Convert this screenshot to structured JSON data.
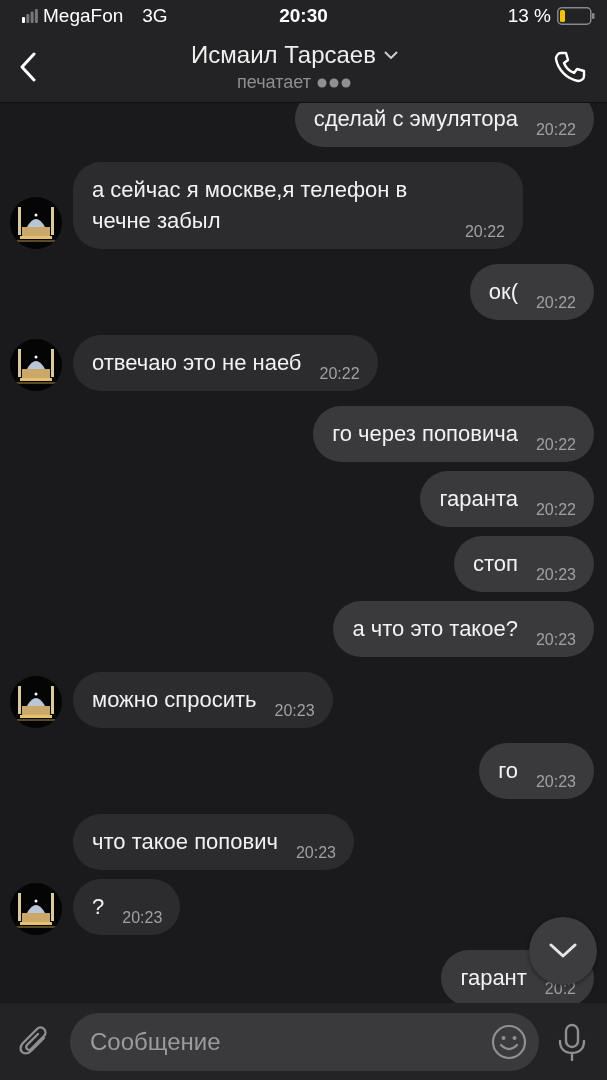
{
  "status_bar": {
    "carrier": "MegaFon",
    "network": "3G",
    "time": "20:30",
    "battery": "13 %"
  },
  "header": {
    "title": "Исмаил Тарсаев",
    "subtitle": "печатает"
  },
  "messages": [
    {
      "kind": "out",
      "text": "сделай с эмулятора",
      "time": "20:22"
    },
    {
      "kind": "in",
      "text": "а сейчас я москве,я телефон в чечне забыл",
      "time": "20:22",
      "avatar": true
    },
    {
      "kind": "out",
      "text": "ок(",
      "time": "20:22"
    },
    {
      "kind": "in",
      "text": "отвечаю это не наеб",
      "time": "20:22",
      "avatar": true
    },
    {
      "kind": "out",
      "text": "го через поповича",
      "time": "20:22"
    },
    {
      "kind": "out",
      "text": "гаранта",
      "time": "20:22"
    },
    {
      "kind": "out",
      "text": "стоп",
      "time": "20:23"
    },
    {
      "kind": "out",
      "text": "а что это такое?",
      "time": "20:23"
    },
    {
      "kind": "in",
      "text": "можно спросить",
      "time": "20:23",
      "avatar": true
    },
    {
      "kind": "out",
      "text": "го",
      "time": "20:23"
    },
    {
      "kind": "in",
      "text": "что такое попович",
      "time": "20:23",
      "avatar": false
    },
    {
      "kind": "in",
      "text": "?",
      "time": "20:23",
      "avatar": true
    },
    {
      "kind": "out",
      "text": "гарант",
      "time": "20:2"
    }
  ],
  "composer": {
    "placeholder": "Сообщение"
  }
}
